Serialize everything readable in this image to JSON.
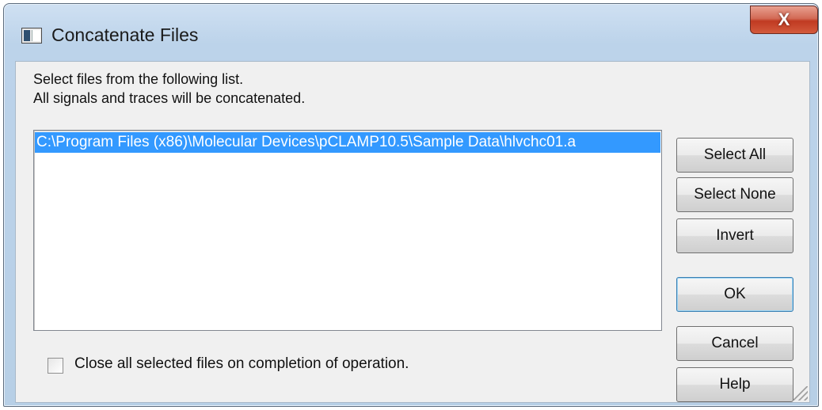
{
  "window": {
    "title": "Concatenate Files",
    "close_label": "X"
  },
  "instructions": {
    "line1": "Select files from the following list.",
    "line2": "All signals and traces will be concatenated."
  },
  "file_list": {
    "items": [
      {
        "path": "C:\\Program Files (x86)\\Molecular Devices\\pCLAMP10.5\\Sample Data\\hlvchc01.a",
        "selected": true
      }
    ]
  },
  "buttons": {
    "select_all": "Select All",
    "select_none": "Select None",
    "invert": "Invert",
    "ok": "OK",
    "cancel": "Cancel",
    "help": "Help"
  },
  "options": {
    "close_on_completion_label": "Close all selected files on completion of operation.",
    "close_on_completion_checked": false
  },
  "colors": {
    "selection": "#3399ff",
    "close_button": "#c7422a"
  }
}
